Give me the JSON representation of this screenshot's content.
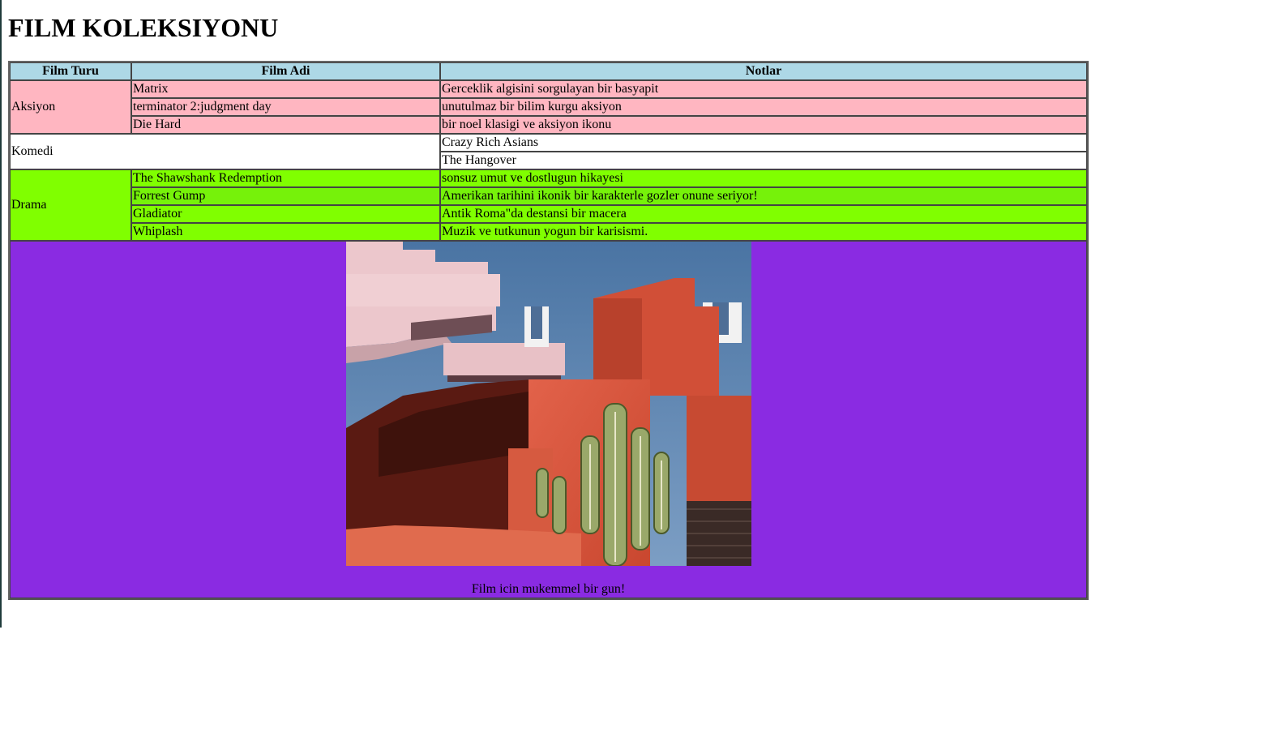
{
  "page": {
    "title": "FILM KOLEKSIYONU"
  },
  "table": {
    "headers": [
      "Film Turu",
      "Film Adi",
      "Notlar"
    ],
    "groups": [
      {
        "genre": "Aksiyon",
        "color": "#ffb6c1",
        "rows": [
          {
            "name": "Matrix",
            "note": "Gerceklik algisini sorgulayan bir basyapit"
          },
          {
            "name": "terminator 2:judgment day",
            "note": "unutulmaz bir bilim kurgu aksiyon"
          },
          {
            "name": "Die Hard",
            "note": "bir noel klasigi ve aksiyon ikonu"
          }
        ]
      },
      {
        "genre": "Komedi",
        "color": "#ffffff",
        "rows": [
          {
            "name": "Crazy Rich Asians"
          },
          {
            "name": "The Hangover"
          }
        ]
      },
      {
        "genre": "Drama",
        "color": "#80ff00",
        "rows": [
          {
            "name": "The Shawshank Redemption",
            "note": "sonsuz umut ve dostlugun hikayesi"
          },
          {
            "name": "Forrest Gump",
            "note": "Amerikan tarihini ikonik bir karakterle gozler onune seriyor!"
          },
          {
            "name": "Gladiator",
            "note": "Antik Roma\"da destansi bir macera"
          },
          {
            "name": "Whiplash",
            "note": "Muzik ve tutkunun yogun bir karisismi."
          }
        ]
      }
    ],
    "header_color": "#add8e6",
    "footer_color": "#8a2be2",
    "caption": "Film icin mukemmel bir gun!"
  }
}
